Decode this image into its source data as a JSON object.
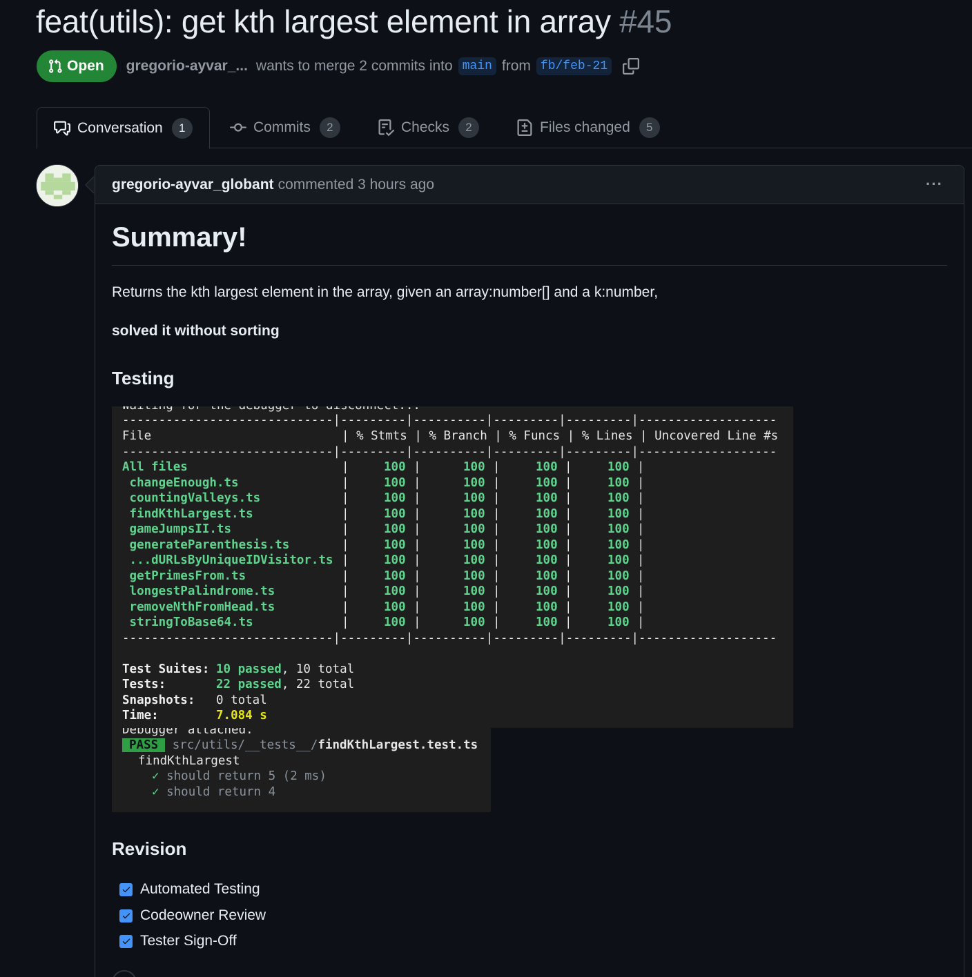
{
  "pr": {
    "title": "feat(utils): get kth largest element in array",
    "number": "#45",
    "state": "Open",
    "author": "gregorio-ayvar_...",
    "merge_text": "wants to merge 2 commits into",
    "base_branch": "main",
    "from_text": "from",
    "head_branch": "fb/feb-21"
  },
  "tabs": [
    {
      "label": "Conversation",
      "count": "1",
      "icon": "comment-discussion-icon"
    },
    {
      "label": "Commits",
      "count": "2",
      "icon": "git-commit-icon"
    },
    {
      "label": "Checks",
      "count": "2",
      "icon": "checklist-icon"
    },
    {
      "label": "Files changed",
      "count": "5",
      "icon": "file-diff-icon"
    }
  ],
  "comment": {
    "author": "gregorio-ayvar_globant",
    "action": "commented 3 hours ago",
    "menu_icon": "kebab-horizontal-icon",
    "heading": "Summary!",
    "para1": "Returns the kth largest element in the array, given an array:number[] and a k:number,",
    "para2": "solved it without sorting",
    "testing_heading": "Testing",
    "revision_heading": "Revision"
  },
  "terminal": {
    "top_line": "Waiting for the debugger to disconnect...",
    "divider": "-----------------------------|---------|----------|---------|---------|-------------------",
    "header": {
      "file": "File",
      "stmts": "% Stmts",
      "branch": "% Branch",
      "funcs": "% Funcs",
      "lines": "% Lines",
      "uncovered": "Uncovered Line #s"
    },
    "rows": [
      {
        "file": "All files",
        "stmts": "100",
        "branch": "100",
        "funcs": "100",
        "lines": "100"
      },
      {
        "file": " changeEnough.ts",
        "stmts": "100",
        "branch": "100",
        "funcs": "100",
        "lines": "100"
      },
      {
        "file": " countingValleys.ts",
        "stmts": "100",
        "branch": "100",
        "funcs": "100",
        "lines": "100"
      },
      {
        "file": " findKthLargest.ts",
        "stmts": "100",
        "branch": "100",
        "funcs": "100",
        "lines": "100"
      },
      {
        "file": " gameJumpsII.ts",
        "stmts": "100",
        "branch": "100",
        "funcs": "100",
        "lines": "100"
      },
      {
        "file": " generateParenthesis.ts",
        "stmts": "100",
        "branch": "100",
        "funcs": "100",
        "lines": "100"
      },
      {
        "file": " ...dURLsByUniqueIDVisitor.ts",
        "stmts": "100",
        "branch": "100",
        "funcs": "100",
        "lines": "100"
      },
      {
        "file": " getPrimesFrom.ts",
        "stmts": "100",
        "branch": "100",
        "funcs": "100",
        "lines": "100"
      },
      {
        "file": " longestPalindrome.ts",
        "stmts": "100",
        "branch": "100",
        "funcs": "100",
        "lines": "100"
      },
      {
        "file": " removeNthFromHead.ts",
        "stmts": "100",
        "branch": "100",
        "funcs": "100",
        "lines": "100"
      },
      {
        "file": " stringToBase64.ts",
        "stmts": "100",
        "branch": "100",
        "funcs": "100",
        "lines": "100"
      }
    ],
    "summary": [
      {
        "label": "Test Suites:",
        "pass": "10 passed",
        "rest": ", 10 total"
      },
      {
        "label": "Tests:",
        "pass": "22 passed",
        "rest": ", 22 total"
      },
      {
        "label": "Snapshots:",
        "pass": "",
        "rest": "0 total"
      },
      {
        "label": "Time:",
        "time": "7.084 s"
      }
    ]
  },
  "terminal2": {
    "top_line": "Debugger attached.",
    "pass_badge": "PASS",
    "path_prefix": "src/utils/__tests__/",
    "path_file": "findKthLargest.test.ts",
    "suite": "findKthLargest",
    "tests": [
      {
        "check": "✓",
        "name": "should return 5 (2 ms)"
      },
      {
        "check": "✓",
        "name": "should return 4"
      }
    ]
  },
  "checklist": [
    {
      "label": "Automated Testing",
      "checked": true
    },
    {
      "label": "Codeowner Review",
      "checked": true
    },
    {
      "label": "Tester Sign-Off",
      "checked": true
    }
  ],
  "colors": {
    "open": "#238636",
    "link": "#4493f8",
    "bg": "#0d1117",
    "term_green": "#5fd38d"
  }
}
